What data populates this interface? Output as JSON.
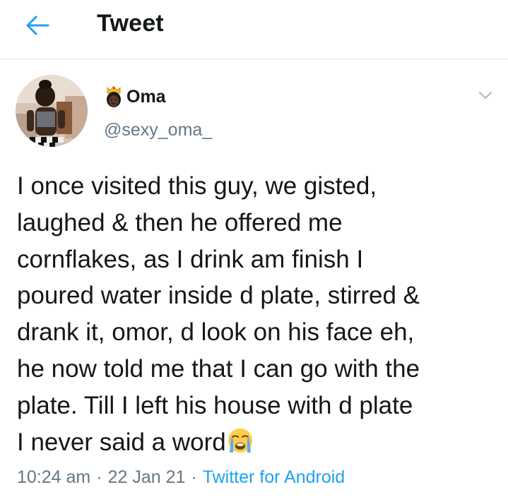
{
  "header": {
    "title": "Tweet",
    "back_icon": "arrow-left-icon",
    "accent_color": "#1da1f2"
  },
  "author": {
    "name": "Oma",
    "name_emoji": "crowned-face-emoji",
    "handle": "@sexy_oma_"
  },
  "tweet": {
    "text": "I once visited this guy, we gisted,\nlaughed & then he offered me\ncornflakes, as I drink am finish I\npoured water inside d plate, stirred &\ndrank it, omor, d look on his face eh,\nhe now told me that I can go with the\nplate. Till I left his house with d plate\nI never said a word",
    "trailing_emoji": "loudly-crying-face-emoji",
    "time": "10:24 am",
    "separator": "·",
    "date": "22 Jan 21",
    "source": "Twitter for Android"
  },
  "colors": {
    "text": "#14171a",
    "secondary": "#657786",
    "link": "#1da1f2",
    "divider": "#e1e8ed"
  }
}
